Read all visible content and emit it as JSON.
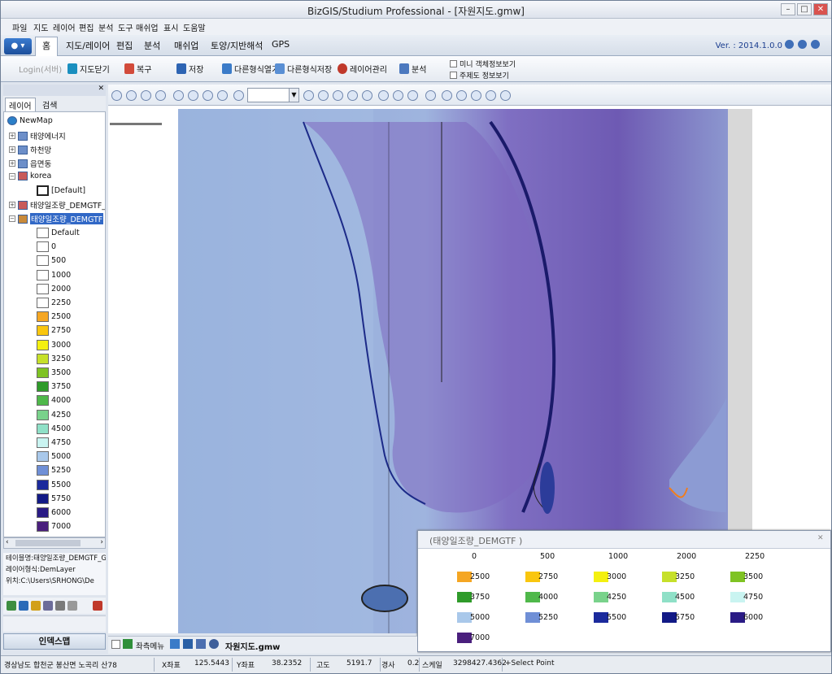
{
  "window": {
    "title": "BizGIS/Studium Professional - [자원지도.gmw]"
  },
  "menu": [
    "파일",
    "지도",
    "레이어",
    "편집",
    "분석",
    "도구",
    "매쉬업",
    "표시",
    "도움말"
  ],
  "ribbon_tabs": [
    "홈",
    "지도/레이어",
    "편집",
    "분석",
    "매쉬업",
    "토양/지반해석",
    "GPS"
  ],
  "version": "Ver. : 2014.1.0.0",
  "ribbon": {
    "login": "Login(서버)",
    "close_map": "지도닫기",
    "restore": "복구",
    "save": "저장",
    "open_other": "다른형식열기",
    "save_other": "다른형식저장",
    "layer_manage": "레이어관리",
    "analysis": "분석",
    "mini_view": "미니 객체정보보기",
    "annotation_view": "주제도 정보보기"
  },
  "left_panel": {
    "tab_layer": "레이어",
    "tab_search": "검색",
    "tree": [
      {
        "label": "NewMap"
      },
      {
        "label": "태양에너지"
      },
      {
        "label": "하천망"
      },
      {
        "label": "읍면동"
      },
      {
        "label": "korea"
      },
      {
        "label": "[Default]"
      },
      {
        "label": "태양일조량_DEMGTF_G"
      },
      {
        "label": "태양일조량_DEMGTF"
      }
    ],
    "legend_items": [
      {
        "label": "Default",
        "color": "#ffffff"
      },
      {
        "label": "0",
        "color": "#ffffff"
      },
      {
        "label": "500",
        "color": "#ffffff"
      },
      {
        "label": "1000",
        "color": "#ffffff"
      },
      {
        "label": "2000",
        "color": "#ffffff"
      },
      {
        "label": "2250",
        "color": "#ffffff"
      },
      {
        "label": "2500",
        "color": "#f5a623"
      },
      {
        "label": "2750",
        "color": "#f9c60e"
      },
      {
        "label": "3000",
        "color": "#f4f010"
      },
      {
        "label": "3250",
        "color": "#c6e02a"
      },
      {
        "label": "3500",
        "color": "#7fc323"
      },
      {
        "label": "3750",
        "color": "#2f9b2a"
      },
      {
        "label": "4000",
        "color": "#4fb84a"
      },
      {
        "label": "4250",
        "color": "#79d28b"
      },
      {
        "label": "4500",
        "color": "#8fe0c7"
      },
      {
        "label": "4750",
        "color": "#c9f4f1"
      },
      {
        "label": "5000",
        "color": "#a9c8ea"
      },
      {
        "label": "5250",
        "color": "#6f8fd6"
      },
      {
        "label": "5500",
        "color": "#1b2a9c"
      },
      {
        "label": "5750",
        "color": "#121a86"
      },
      {
        "label": "6000",
        "color": "#2a1b85"
      },
      {
        "label": "7000",
        "color": "#4a1f7d"
      }
    ],
    "info_name": "테이블명:태양일조량_DEMGTF_G",
    "info_type": "레이어형식:DemLayer",
    "info_path": "위치:C:\\Users\\SRHONG\\De",
    "print_map": "인덱스맵"
  },
  "map": {
    "doc_tab": "자원지도.gmw",
    "coordinate_menu": "좌측메뉴"
  },
  "legend_window": {
    "title": "(태양일조량_DEMGTF )",
    "header": [
      "0",
      "500",
      "1000",
      "2000",
      "2250"
    ],
    "items": [
      {
        "label": "2500",
        "color": "#f5a623"
      },
      {
        "label": "2750",
        "color": "#f9c60e"
      },
      {
        "label": "3000",
        "color": "#f4f010"
      },
      {
        "label": "3250",
        "color": "#c6e02a"
      },
      {
        "label": "3500",
        "color": "#7fc323"
      },
      {
        "label": "3750",
        "color": "#2f9b2a"
      },
      {
        "label": "4000",
        "color": "#4fb84a"
      },
      {
        "label": "4250",
        "color": "#79d28b"
      },
      {
        "label": "4500",
        "color": "#8fe0c7"
      },
      {
        "label": "4750",
        "color": "#c9f4f1"
      },
      {
        "label": "5000",
        "color": "#a9c8ea"
      },
      {
        "label": "5250",
        "color": "#6f8fd6"
      },
      {
        "label": "5500",
        "color": "#1b2a9c"
      },
      {
        "label": "5750",
        "color": "#121a86"
      },
      {
        "label": "6000",
        "color": "#2a1b85"
      },
      {
        "label": "7000",
        "color": "#4a1f7d"
      }
    ]
  },
  "status": {
    "address": "경상남도 합천군 봉산면 노곡리 산78",
    "x_label": "X좌표",
    "x_value": "125.5443",
    "y_label": "Y좌표",
    "y_value": "38.2352",
    "elev_label": "고도",
    "elev_value": "5191.7",
    "slope_label": "경사",
    "slope_value": "0.2",
    "scale_label": "스케일",
    "scale_value": "3298427.4362",
    "mode": "+Select Point"
  }
}
